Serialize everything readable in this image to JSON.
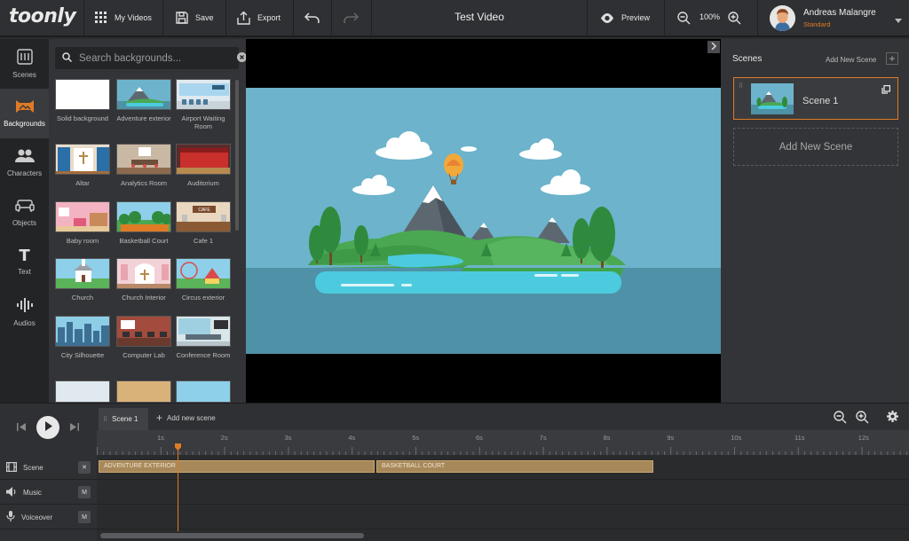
{
  "app": {
    "logo_text": "toonly",
    "project_title": "Test Video"
  },
  "toolbar": {
    "my_videos": "My Videos",
    "save": "Save",
    "export": "Export",
    "preview": "Preview",
    "zoom_level": "100%"
  },
  "user": {
    "name": "Andreas Malangre",
    "plan": "Standard"
  },
  "sidebar": {
    "items": [
      {
        "label": "Scenes",
        "icon": "scenes-icon"
      },
      {
        "label": "Backgrounds",
        "icon": "backgrounds-icon"
      },
      {
        "label": "Characters",
        "icon": "characters-icon"
      },
      {
        "label": "Objects",
        "icon": "objects-icon"
      },
      {
        "label": "Text",
        "icon": "text-icon"
      },
      {
        "label": "Audios",
        "icon": "audios-icon"
      }
    ]
  },
  "backgrounds": {
    "search_placeholder": "Search backgrounds...",
    "items": [
      {
        "label": "Solid background"
      },
      {
        "label": "Adventure exterior"
      },
      {
        "label": "Airport Waiting Room"
      },
      {
        "label": "Altar"
      },
      {
        "label": "Analytics Room"
      },
      {
        "label": "Auditorium"
      },
      {
        "label": "Baby room"
      },
      {
        "label": "Basketball Court"
      },
      {
        "label": "Cafe 1"
      },
      {
        "label": "Church"
      },
      {
        "label": "Church Interior"
      },
      {
        "label": "Circus exterior"
      },
      {
        "label": "City Silhouette"
      },
      {
        "label": "Computer Lab"
      },
      {
        "label": "Conference Room"
      }
    ]
  },
  "canvas": {
    "thumb_cafe_sign": "CAFE"
  },
  "scenes_panel": {
    "title": "Scenes",
    "add_link": "Add New Scene",
    "scene_card_label": "Scene 1",
    "add_box_label": "Add New Scene"
  },
  "timeline": {
    "tab_label": "Scene 1",
    "add_scene": "Add new scene",
    "ticks": [
      "1s",
      "2s",
      "3s",
      "4s",
      "5s",
      "6s",
      "7s",
      "8s",
      "9s",
      "10s",
      "11s",
      "12s"
    ],
    "tracks": [
      {
        "label": "Scene",
        "btn": "✕"
      },
      {
        "label": "Music",
        "btn": "M"
      },
      {
        "label": "Voiceover",
        "btn": "M"
      }
    ],
    "clips": [
      {
        "label": "ADVENTURE EXTERIOR"
      },
      {
        "label": "BASKETBALL COURT"
      }
    ]
  },
  "colors": {
    "accent": "#e07b25",
    "sky": "#6cb3cb",
    "water": "#4f91a6"
  }
}
